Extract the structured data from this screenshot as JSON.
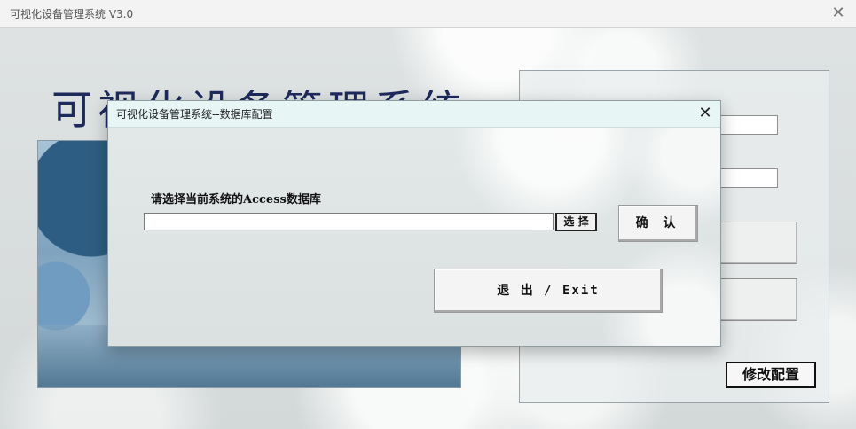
{
  "main_window": {
    "title": "可视化设备管理系统 V3.0",
    "heading": "可视化设备管理系统",
    "modify_config_label": "修改配置",
    "close_icon": "close-icon"
  },
  "dialog": {
    "title": "可视化设备管理系统--数据库配置",
    "prompt": "请选择当前系统的Access数据库",
    "path_value": "",
    "choose_label": "选 择",
    "confirm_label": "确 认",
    "exit_label": "退 出 / Exit",
    "close_icon": "close-icon"
  },
  "colors": {
    "heading": "#1e2a5c",
    "dialog_titlebar": "#e7f5f5",
    "accent_image": "#5d8db2"
  }
}
